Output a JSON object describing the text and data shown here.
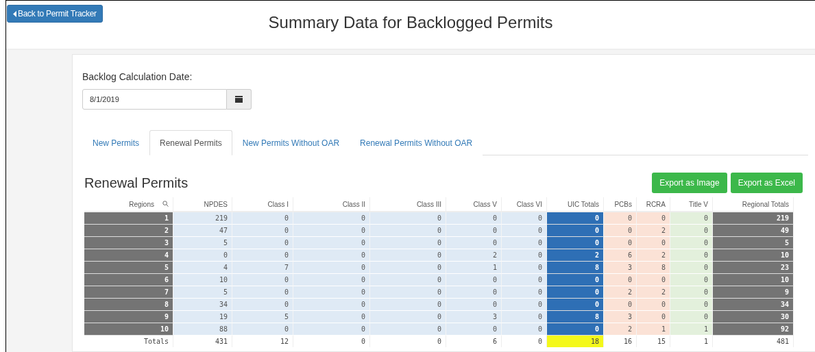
{
  "header": {
    "back_button": "Back to Permit Tracker",
    "title": "Summary Data for Backlogged Permits"
  },
  "date_field": {
    "label": "Backlog Calculation Date:",
    "value": "8/1/2019"
  },
  "tabs": [
    {
      "label": "New Permits",
      "selected": false
    },
    {
      "label": "Renewal Permits",
      "selected": true
    },
    {
      "label": "New Permits Without OAR",
      "selected": false
    },
    {
      "label": "Renewal Permits Without OAR",
      "selected": false
    }
  ],
  "section_title": "Renewal Permits",
  "buttons": [
    "Export as Image",
    "Export as Excel"
  ],
  "table": {
    "columns": [
      {
        "label": "Regions",
        "color": "#747474"
      },
      {
        "label": "NPDES",
        "color": "#dfeaf5"
      },
      {
        "label": "Class I",
        "color": "#dfeaf5"
      },
      {
        "label": "Class II",
        "color": "#dfeaf5"
      },
      {
        "label": "Class III",
        "color": "#dfeaf5"
      },
      {
        "label": "Class V",
        "color": "#dfeaf5"
      },
      {
        "label": "Class VI",
        "color": "#dfeaf5"
      },
      {
        "label": "UIC Totals",
        "color": "#2e6fb5"
      },
      {
        "label": "PCBs",
        "color": "#fbe2d6"
      },
      {
        "label": "RCRA",
        "color": "#fbe2d6"
      },
      {
        "label": "Title V",
        "color": "#e3f0dc"
      },
      {
        "label": "Regional Totals",
        "color": "#747474"
      }
    ],
    "rows": [
      [
        "1",
        "219",
        "0",
        "0",
        "0",
        "0",
        "0",
        "0",
        "0",
        "0",
        "0",
        "219"
      ],
      [
        "2",
        "47",
        "0",
        "0",
        "0",
        "0",
        "0",
        "0",
        "0",
        "2",
        "0",
        "49"
      ],
      [
        "3",
        "5",
        "0",
        "0",
        "0",
        "0",
        "0",
        "0",
        "0",
        "0",
        "0",
        "5"
      ],
      [
        "4",
        "0",
        "0",
        "0",
        "0",
        "2",
        "0",
        "2",
        "6",
        "2",
        "0",
        "10"
      ],
      [
        "5",
        "4",
        "7",
        "0",
        "0",
        "1",
        "0",
        "8",
        "3",
        "8",
        "0",
        "23"
      ],
      [
        "6",
        "10",
        "0",
        "0",
        "0",
        "0",
        "0",
        "0",
        "0",
        "0",
        "0",
        "10"
      ],
      [
        "7",
        "5",
        "0",
        "0",
        "0",
        "0",
        "0",
        "0",
        "2",
        "2",
        "0",
        "9"
      ],
      [
        "8",
        "34",
        "0",
        "0",
        "0",
        "0",
        "0",
        "0",
        "0",
        "0",
        "0",
        "34"
      ],
      [
        "9",
        "19",
        "5",
        "0",
        "0",
        "3",
        "0",
        "8",
        "3",
        "0",
        "0",
        "30"
      ],
      [
        "10",
        "88",
        "0",
        "0",
        "0",
        "0",
        "0",
        "0",
        "2",
        "1",
        "1",
        "92"
      ]
    ],
    "totals": [
      "Totals",
      "431",
      "12",
      "0",
      "0",
      "6",
      "0",
      "18",
      "16",
      "15",
      "1",
      "481"
    ]
  }
}
